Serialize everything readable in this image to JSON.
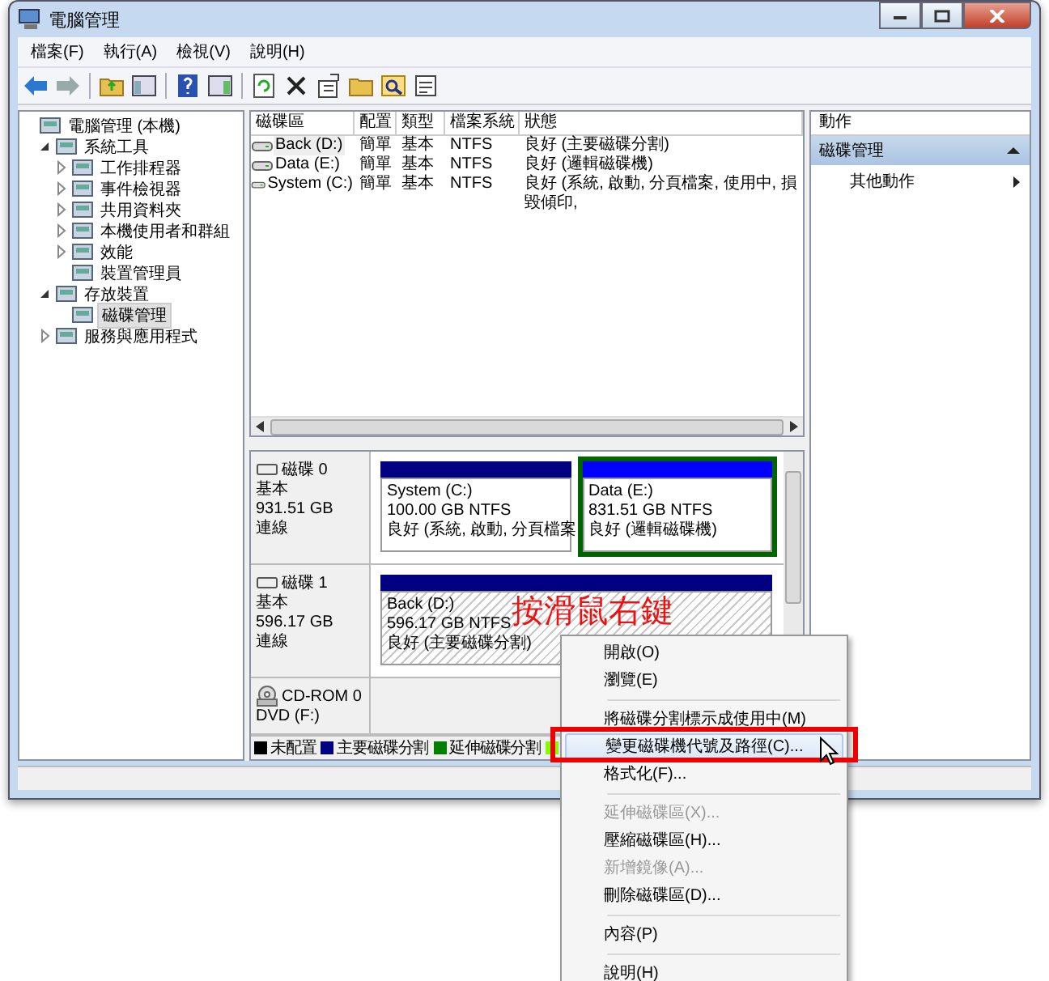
{
  "window": {
    "title": "電腦管理"
  },
  "menu_bar": [
    "檔案(F)",
    "執行(A)",
    "檢視(V)",
    "說明(H)"
  ],
  "tree": [
    {
      "label": "電腦管理 (本機)",
      "selected": false,
      "children": [
        {
          "label": "系統工具",
          "expanded": true,
          "selected": false,
          "children": [
            {
              "label": "工作排程器",
              "expanded": false,
              "selected": false
            },
            {
              "label": "事件檢視器",
              "expanded": false,
              "selected": false
            },
            {
              "label": "共用資料夾",
              "expanded": false,
              "selected": false
            },
            {
              "label": "本機使用者和群組",
              "expanded": false,
              "selected": false
            },
            {
              "label": "效能",
              "expanded": false,
              "selected": false
            },
            {
              "label": "裝置管理員",
              "selected": false
            }
          ]
        },
        {
          "label": "存放裝置",
          "expanded": true,
          "selected": false,
          "children": [
            {
              "label": "磁碟管理",
              "selected": true
            }
          ]
        },
        {
          "label": "服務與應用程式",
          "expanded": false,
          "selected": false
        }
      ]
    }
  ],
  "volume_table": {
    "columns": [
      "磁碟區",
      "配置",
      "類型",
      "檔案系統",
      "狀態"
    ],
    "rows": [
      {
        "cells": [
          "Back (D:)",
          "簡單",
          "基本",
          "NTFS",
          "良好 (主要磁碟分割)"
        ],
        "selected": true
      },
      {
        "cells": [
          "Data (E:)",
          "簡單",
          "基本",
          "NTFS",
          "良好 (邏輯磁碟機)"
        ],
        "selected": false
      },
      {
        "cells": [
          "System (C:)",
          "簡單",
          "基本",
          "NTFS",
          "良好 (系統, 啟動, 分頁檔案, 使用中, 損毀傾印,"
        ],
        "selected": false
      }
    ]
  },
  "disks": [
    {
      "kind": "disk",
      "name": "磁碟 0",
      "lines": [
        "基本",
        "931.51 GB",
        "連線"
      ],
      "partitions": [
        {
          "kind": "primary",
          "color": "#000080",
          "selected": false,
          "lines": [
            "System  (C:)",
            "100.00 GB NTFS",
            "良好 (系統, 啟動, 分頁檔案"
          ]
        },
        {
          "kind": "logical",
          "color": "#0000ff",
          "selected": false,
          "lines": [
            "Data  (E:)",
            "831.51 GB NTFS",
            "良好 (邏輯磁碟機)"
          ]
        }
      ]
    },
    {
      "kind": "disk",
      "name": "磁碟 1",
      "lines": [
        "基本",
        "596.17 GB",
        "連線"
      ],
      "partitions": [
        {
          "kind": "primary",
          "color": "#000080",
          "selected": true,
          "lines": [
            "Back  (D:)",
            "596.17 GB NTFS",
            "良好 (主要磁碟分割)"
          ]
        }
      ]
    },
    {
      "kind": "cdrom",
      "name": "CD-ROM 0",
      "lines": [
        "DVD (F:)"
      ]
    }
  ],
  "legend": [
    {
      "label": "未配置",
      "color": "#000000"
    },
    {
      "label": "主要磁碟分割",
      "color": "#000080"
    },
    {
      "label": "延伸磁碟分割",
      "color": "#008000"
    },
    {
      "color": "#80ff00"
    }
  ],
  "actions": {
    "title": "動作",
    "section": {
      "label": "磁碟管理",
      "expanded": true
    },
    "items": [
      {
        "label": "其他動作"
      }
    ]
  },
  "annotation": "按滑鼠右鍵",
  "context_menu": [
    {
      "kind": "item",
      "label": "開啟(O)",
      "disabled": false,
      "selected": false
    },
    {
      "kind": "item",
      "label": "瀏覽(E)",
      "disabled": false,
      "selected": false
    },
    {
      "kind": "separator"
    },
    {
      "kind": "item",
      "label": "將磁碟分割標示成使用中(M)",
      "disabled": false,
      "selected": false
    },
    {
      "kind": "item",
      "label": "變更磁碟機代號及路徑(C)...",
      "disabled": false,
      "selected": true
    },
    {
      "kind": "item",
      "label": "格式化(F)...",
      "disabled": false,
      "selected": false
    },
    {
      "kind": "separator"
    },
    {
      "kind": "item",
      "label": "延伸磁碟區(X)...",
      "disabled": true,
      "selected": false
    },
    {
      "kind": "item",
      "label": "壓縮磁碟區(H)...",
      "disabled": false,
      "selected": false
    },
    {
      "kind": "item",
      "label": "新增鏡像(A)...",
      "disabled": true,
      "selected": false
    },
    {
      "kind": "item",
      "label": "刪除磁碟區(D)...",
      "disabled": false,
      "selected": false
    },
    {
      "kind": "separator"
    },
    {
      "kind": "item",
      "label": "內容(P)",
      "disabled": false,
      "selected": false
    },
    {
      "kind": "separator"
    },
    {
      "kind": "item",
      "label": "說明(H)",
      "disabled": false,
      "selected": false
    }
  ]
}
